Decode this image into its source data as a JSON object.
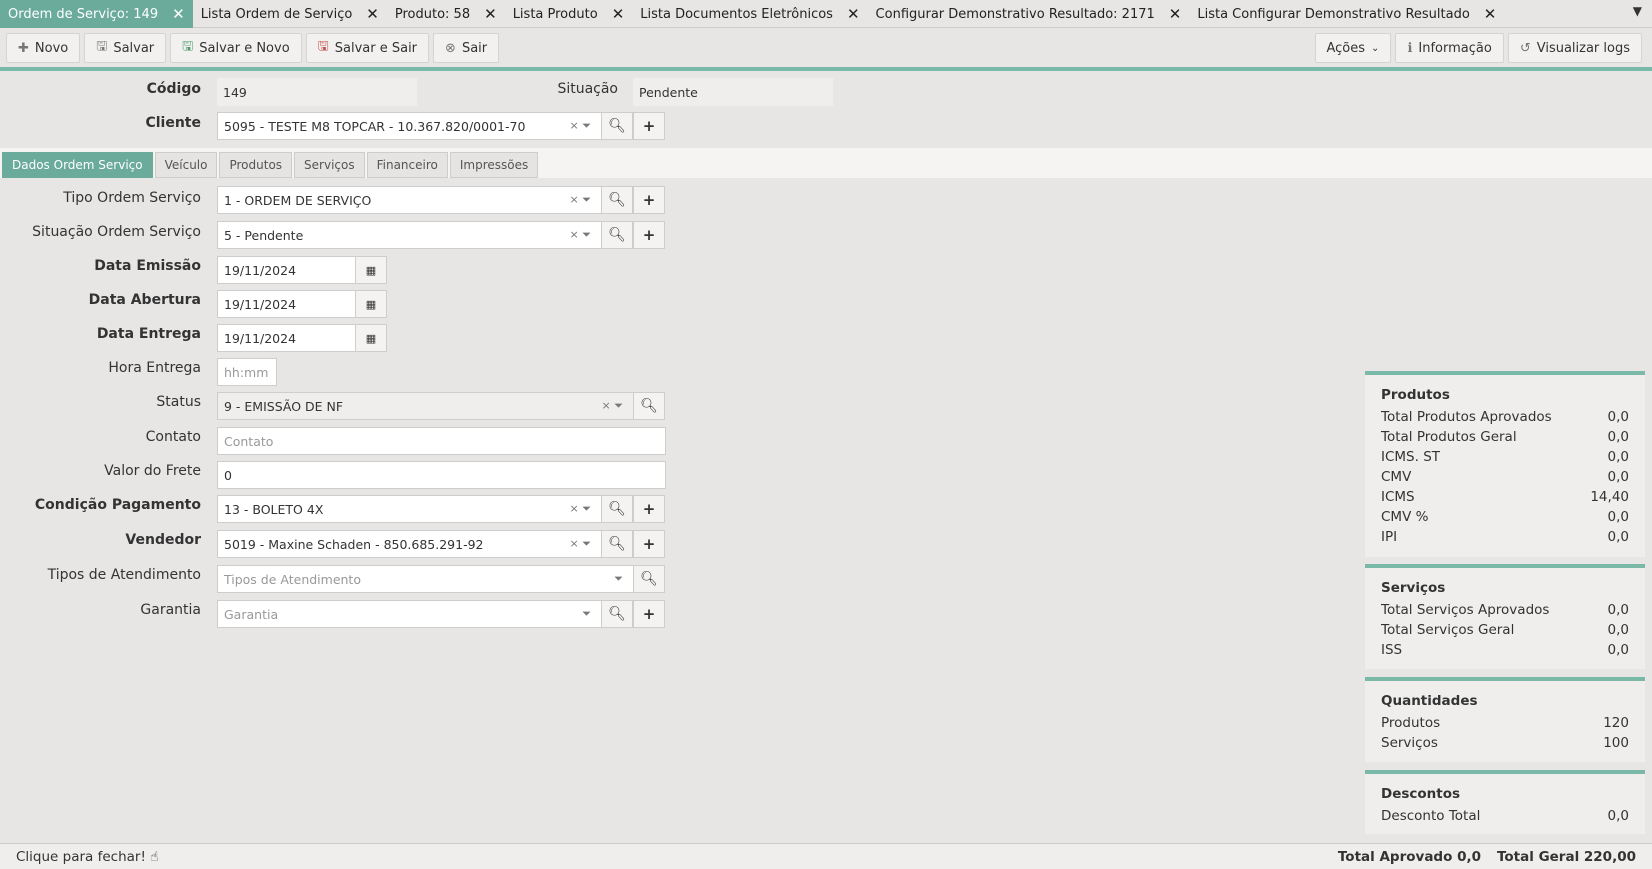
{
  "tabs": [
    {
      "label": "Ordem de Serviço: 149",
      "active": true
    },
    {
      "label": "Lista Ordem de Serviço"
    },
    {
      "label": "Produto: 58"
    },
    {
      "label": "Lista Produto"
    },
    {
      "label": "Lista Documentos Eletrônicos"
    },
    {
      "label": "Configurar Demonstrativo Resultado: 2171"
    },
    {
      "label": "Lista Configurar Demonstrativo Resultado"
    }
  ],
  "toolbar": {
    "novo": "Novo",
    "salvar": "Salvar",
    "salvar_novo": "Salvar e Novo",
    "salvar_sair": "Salvar e Sair",
    "sair": "Sair",
    "acoes": "Ações",
    "informacao": "Informação",
    "visualizar_logs": "Visualizar logs"
  },
  "header": {
    "codigo_label": "Código",
    "codigo_value": "149",
    "situacao_label": "Situação",
    "situacao_value": "Pendente",
    "cliente_label": "Cliente",
    "cliente_value": "5095 - TESTE M8 TOPCAR - 10.367.820/0001-70"
  },
  "subtabs": [
    "Dados Ordem Serviço",
    "Veículo",
    "Produtos",
    "Serviços",
    "Financeiro",
    "Impressões"
  ],
  "form": {
    "tipo_os_label": "Tipo Ordem Serviço",
    "tipo_os_value": "1 - ORDEM DE SERVIÇO",
    "situacao_os_label": "Situação Ordem Serviço",
    "situacao_os_value": "5 - Pendente",
    "data_emissao_label": "Data Emissão",
    "data_emissao_value": "19/11/2024",
    "data_abertura_label": "Data Abertura",
    "data_abertura_value": "19/11/2024",
    "data_entrega_label": "Data Entrega",
    "data_entrega_value": "19/11/2024",
    "hora_entrega_label": "Hora Entrega",
    "hora_entrega_placeholder": "hh:mm",
    "status_label": "Status",
    "status_value": "9 - EMISSÃO DE NF",
    "contato_label": "Contato",
    "contato_placeholder": "Contato",
    "valor_frete_label": "Valor do Frete",
    "valor_frete_value": "0",
    "cond_pagamento_label": "Condição Pagamento",
    "cond_pagamento_value": "13 - BOLETO 4X",
    "vendedor_label": "Vendedor",
    "vendedor_value": "5019 - Maxine Schaden - 850.685.291-92",
    "tipos_atendimento_label": "Tipos de Atendimento",
    "tipos_atendimento_placeholder": "Tipos de Atendimento",
    "garantia_label": "Garantia",
    "garantia_placeholder": "Garantia"
  },
  "panels": {
    "produtos": {
      "title": "Produtos",
      "rows": [
        {
          "label": "Total Produtos Aprovados",
          "value": "0,0"
        },
        {
          "label": "Total Produtos Geral",
          "value": "0,0"
        },
        {
          "label": "ICMS. ST",
          "value": "0,0"
        },
        {
          "label": "CMV",
          "value": "0,0"
        },
        {
          "label": "ICMS",
          "value": "14,40"
        },
        {
          "label": "CMV %",
          "value": "0,0"
        },
        {
          "label": "IPI",
          "value": "0,0"
        }
      ]
    },
    "servicos": {
      "title": "Serviços",
      "rows": [
        {
          "label": "Total Serviços Aprovados",
          "value": "0,0"
        },
        {
          "label": "Total Serviços Geral",
          "value": "0,0"
        },
        {
          "label": "ISS",
          "value": "0,0"
        }
      ]
    },
    "quantidades": {
      "title": "Quantidades",
      "rows": [
        {
          "label": "Produtos",
          "value": "120"
        },
        {
          "label": "Serviços",
          "value": "100"
        }
      ]
    },
    "descontos": {
      "title": "Descontos",
      "rows": [
        {
          "label": "Desconto Total",
          "value": "0,0"
        }
      ]
    }
  },
  "footer": {
    "close_hint": "Clique para fechar!",
    "total_aprovado": "Total Aprovado 0,0",
    "total_geral": "Total Geral 220,00"
  },
  "colors": {
    "accent": "#6aab9c",
    "accent_line": "#7ab8a8",
    "background": "#e8e6e5"
  }
}
